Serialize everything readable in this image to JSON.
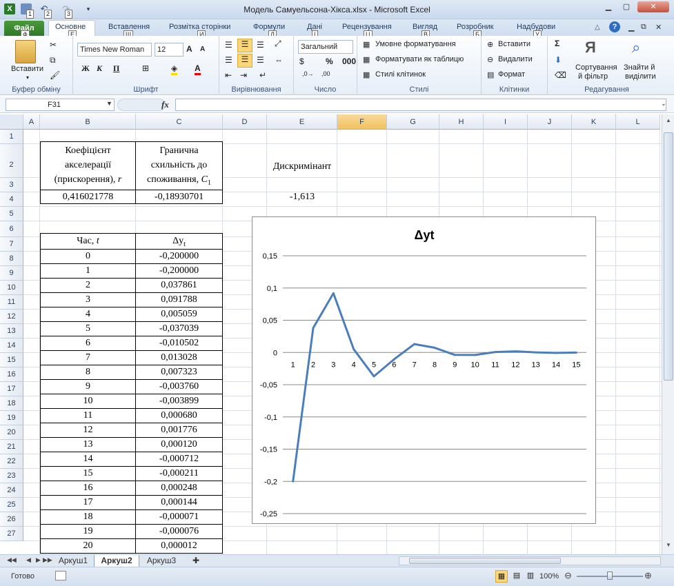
{
  "window": {
    "title": "Модель Самуельсона-Хікса.xlsx - Microsoft Excel"
  },
  "qat": {
    "keytips": [
      "1",
      "2",
      "3"
    ]
  },
  "tabs": [
    {
      "label": "Файл",
      "key": "Ф"
    },
    {
      "label": "Основне",
      "key": ""
    },
    {
      "label": "Вставлення",
      "key": "Е"
    },
    {
      "label": "Розмітка сторінки",
      "key": "Щ"
    },
    {
      "label": "Формули",
      "key": "И"
    },
    {
      "label": "Дані",
      "key": "Л"
    },
    {
      "label": "Рецензування",
      "key": "І"
    },
    {
      "label": "Вигляд",
      "key": "Ц"
    },
    {
      "label": "Розробник",
      "key": "В"
    },
    {
      "label": "Надбудови",
      "key": "Б"
    }
  ],
  "tab_extra_key": "У",
  "ribbon": {
    "paste": "Вставити",
    "font_name": "Times New Roman",
    "font_size": "12",
    "number_format": "Загальний",
    "cond_format": "Умовне форматування",
    "format_table": "Форматувати як таблицю",
    "cell_styles": "Стилі клітинок",
    "insert": "Вставити",
    "delete": "Видалити",
    "format": "Формат",
    "sort_filter_1": "Сортування",
    "sort_filter_2": "й фільтр",
    "find_1": "Знайти й",
    "find_2": "виділити",
    "groups": {
      "clipboard": "Буфер обміну",
      "font": "Шрифт",
      "alignment": "Вирівнювання",
      "number": "Число",
      "styles": "Стилі",
      "cells": "Клітинки",
      "editing": "Редагування"
    }
  },
  "formula_bar": {
    "name_box": "F31",
    "fx": "fx",
    "formula": ""
  },
  "columns": [
    "A",
    "B",
    "C",
    "D",
    "E",
    "F",
    "G",
    "H",
    "I",
    "J",
    "K",
    "L"
  ],
  "rows": [
    "1",
    "2",
    "3",
    "4",
    "5",
    "6",
    "7",
    "8",
    "9",
    "10",
    "11",
    "12",
    "13",
    "14",
    "15",
    "16",
    "17",
    "18",
    "19",
    "20",
    "21",
    "22",
    "23",
    "24",
    "25",
    "26",
    "27"
  ],
  "cells": {
    "B2_l1": "Коефіцієнт",
    "B2_l2": "акселерації",
    "B2_l3": "(прискорення),",
    "B2_var": "r",
    "C2_l1": "Гранична",
    "C2_l2": "схильність до",
    "C2_l3": "споживання,",
    "C2_var": "C",
    "C2_sub": "1",
    "E2": "Дискримінант",
    "B3": "0,416021778",
    "C3": "-0,18930701",
    "E3": "-1,613",
    "B6_txt": "Час,",
    "B6_var": "t",
    "C6_txt": "Δy",
    "C6_sub": "t"
  },
  "table": [
    {
      "t": "0",
      "dy": "-0,200000"
    },
    {
      "t": "1",
      "dy": "-0,200000"
    },
    {
      "t": "2",
      "dy": "0,037861"
    },
    {
      "t": "3",
      "dy": "0,091788"
    },
    {
      "t": "4",
      "dy": "0,005059"
    },
    {
      "t": "5",
      "dy": "-0,037039"
    },
    {
      "t": "6",
      "dy": "-0,010502"
    },
    {
      "t": "7",
      "dy": "0,013028"
    },
    {
      "t": "8",
      "dy": "0,007323"
    },
    {
      "t": "9",
      "dy": "-0,003760"
    },
    {
      "t": "10",
      "dy": "-0,003899"
    },
    {
      "t": "11",
      "dy": "0,000680"
    },
    {
      "t": "12",
      "dy": "0,001776"
    },
    {
      "t": "13",
      "dy": "0,000120"
    },
    {
      "t": "14",
      "dy": "-0,000712"
    },
    {
      "t": "15",
      "dy": "-0,000211"
    },
    {
      "t": "16",
      "dy": "0,000248"
    },
    {
      "t": "17",
      "dy": "0,000144"
    },
    {
      "t": "18",
      "dy": "-0,000071"
    },
    {
      "t": "19",
      "dy": "-0,000076"
    },
    {
      "t": "20",
      "dy": "0,000012"
    }
  ],
  "chart_data": {
    "type": "line",
    "title": "Δyt",
    "categories": [
      "1",
      "2",
      "3",
      "4",
      "5",
      "6",
      "7",
      "8",
      "9",
      "10",
      "11",
      "12",
      "13",
      "14",
      "15"
    ],
    "values": [
      -0.2,
      0.037861,
      0.091788,
      0.005059,
      -0.037039,
      -0.010502,
      0.013028,
      0.007323,
      -0.00376,
      -0.003899,
      0.00068,
      0.001776,
      0.00012,
      -0.000712,
      -0.000211
    ],
    "ylim": [
      -0.25,
      0.15
    ],
    "yticks": [
      "0,15",
      "0,1",
      "0,05",
      "0",
      "-0,05",
      "-0,1",
      "-0,15",
      "-0,2",
      "-0,25"
    ],
    "grid": true,
    "color": "#4a7ebb"
  },
  "sheets": [
    "Аркуш1",
    "Аркуш2",
    "Аркуш3"
  ],
  "active_sheet": "Аркуш2",
  "status": {
    "ready": "Готово",
    "zoom": "100%"
  }
}
